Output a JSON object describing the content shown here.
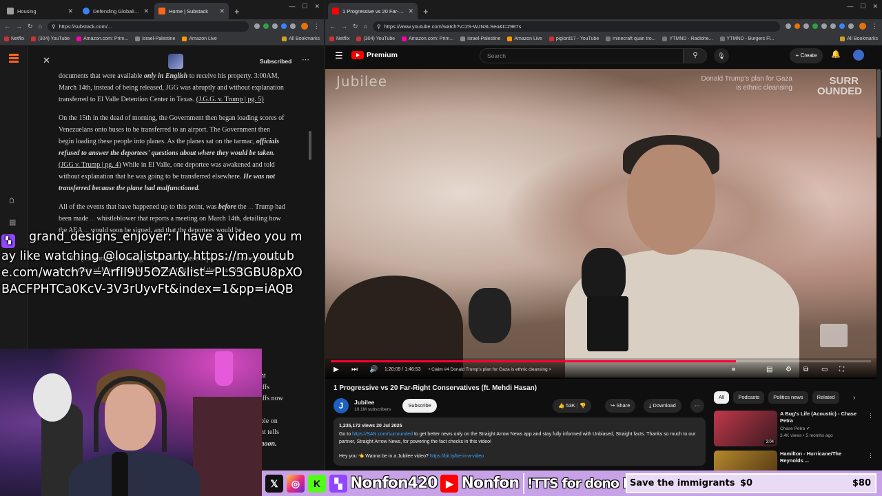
{
  "left_browser": {
    "tabs": [
      {
        "label": "Housing",
        "color": "#9e9e9e",
        "active": false
      },
      {
        "label": "Defending Globalizatio",
        "color": "#3b82f6",
        "active": false
      },
      {
        "label": "Home | Substack",
        "color": "#ff6719",
        "active": true
      }
    ],
    "url": "https://substack.com/...",
    "bookmarks": [
      "Netflix",
      "(304) YouTube",
      "Amazon.com: Prim...",
      "Israel-Palestine",
      "Amazon Live",
      "All Bookmarks"
    ]
  },
  "substack": {
    "subscribed_label": "Subscribed",
    "article": {
      "p1_a": "documents that were available",
      "p1_b": "only in English",
      "p1_c": "to receive his property. 3:00AM, March 14th, instead of being released, JGG was abruptly and without explanation transferred to El Valle Detention Center in Texas.",
      "p1_link": "(J.G.G. v. Trump | pg. 5)",
      "p2_a": "On the 15th in the dead of morning, the Government then began loading scores of Venezuelans onto buses to be transferred to an airport. The Government then begin loading these people into planes. As the planes sat on the tarmac,",
      "p2_b": "officials refused to answer the deportees' questions about where they would be taken.",
      "p2_link": "(JGG v. Trump | pg. 4)",
      "p2_c": "While in El Valle, one deportee was awakened and told without explanation that he was going to be transferred elsewhere.",
      "p2_d": "He was not transferred because the plane had malfunctioned.",
      "p3_a": "All of the events that have happened up to this point, was",
      "p3_b": "before",
      "p3_c": "the",
      "p3_d": "Trump had been made",
      "p3_e": "whistleblower",
      "p3_f": "that reports a meeting on March 14th, detailing how the AEA",
      "p3_g": "would soon be signed, and that the deportees would be",
      "p4_a": "TRO (temporary restraining order) to hold",
      "p4_b": "these deportations was scheduled for the morning of March 15th. At",
      "p4_c": "he court that one of the",
      "p4_d": "n initial",
      "tail_1": "nt",
      "tail_2": "iffs",
      "tail_3": "iffs now",
      "tail_4": "ple on",
      "tail_5": "nt tells",
      "tail_6": "noon."
    }
  },
  "chat": {
    "username": "grand_designs_enjoyer:",
    "message": "I have a video you may like watching @localistparty https://m.youtube.com/watch?v=ArfII9U5OZA&list=PLS3GBU8pXOBACFPHTCa0KcV-3V3rUyvFt&index=1&pp=iAQB"
  },
  "right_browser": {
    "tabs": [
      {
        "label": "1 Progressive vs 20 Far-Rig",
        "color": "#ff0000",
        "active": true
      }
    ],
    "url": "https://www.youtube.com/watch?v=2S-WJN3LSeo&t=2987s",
    "bookmarks": [
      "Netflix",
      "(304) YouTube",
      "Amazon.com: Prim...",
      "Israel-Palestine",
      "Amazon Live",
      "pigiord17 - YouTube",
      "minecraft quan tro...",
      "YTMND - Radiohe...",
      "YTMND - Burgers Fl...",
      "All Bookmarks"
    ]
  },
  "youtube": {
    "logo_text": "Premium",
    "search_placeholder": "Search",
    "create_label": "+ Create",
    "video": {
      "watermark": "Jubilee",
      "overlay_caption": "Donald Trump's plan for Gaza is ethnic cleansing",
      "overlay_brand": "SURR OUNDED",
      "time": "1:20:09 / 1:46:53",
      "chapter": "• Claim #4 Donald Trump's plan for Gaza is ethnic cleansing  >",
      "progress": 0.75
    },
    "title": "1 Progressive vs 20 Far-Right Conservatives (ft. Mehdi Hasan)",
    "channel": {
      "name": "Jubilee",
      "subscribers": "10.1M subscribers",
      "avatar_letter": "J"
    },
    "subscribe_label": "Subscribe",
    "likes": "53K",
    "share_label": "Share",
    "download_label": "Download",
    "description": {
      "meta": "1,235,172 views  20 Jul 2025",
      "line1_a": "Go to",
      "line1_link": "https://SAN.com/surrounded",
      "line1_b": "to get better news only on the Straight Arrow News app and stay fully informed with Unbiased, Straight facts. Thanks so much to our partner, Straight Arrow News, for powering the fact checks in this video!",
      "line2_a": "Hey you 👈 Wanna be in a Jubilee video?",
      "line2_link": "https://bit.ly/be-in-a-video"
    },
    "chips": [
      "All",
      "Podcasts",
      "Politics news",
      "Related"
    ],
    "recommendations": [
      {
        "title": "A Bug's Life (Acoustic) - Chase Petra",
        "channel": "Chase Petra",
        "meta": "3.4K views • 5 months ago",
        "duration": "3:04",
        "thumb": "#c0384a"
      },
      {
        "title": "Hamilton - Hurricane/The Reynolds ...",
        "channel": "",
        "meta": "",
        "duration": "",
        "thumb": "#b5892e"
      }
    ]
  },
  "stream_banner": {
    "handle": "Nonfon420",
    "yt_name": "Nonfon",
    "tts": "!TTS for dono link",
    "goal": {
      "title": "Save the immigrants",
      "current": "$0",
      "target": "$80",
      "progress": 0
    }
  }
}
